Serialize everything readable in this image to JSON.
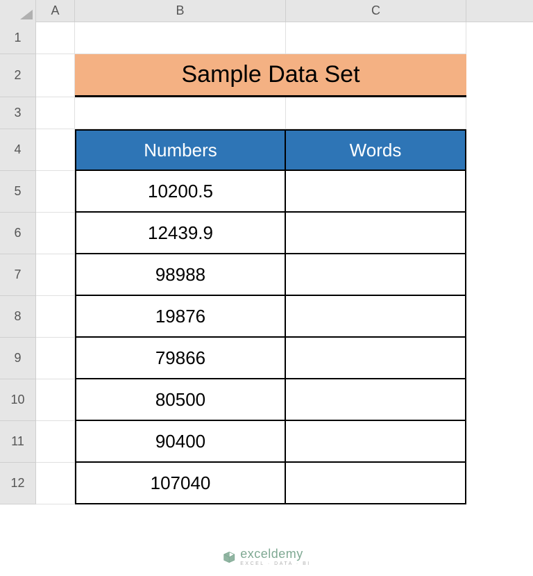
{
  "columns": {
    "A": "A",
    "B": "B",
    "C": "C"
  },
  "rows": [
    "1",
    "2",
    "3",
    "4",
    "5",
    "6",
    "7",
    "8",
    "9",
    "10",
    "11",
    "12"
  ],
  "title": "Sample Data Set",
  "headers": {
    "numbers": "Numbers",
    "words": "Words"
  },
  "data": [
    {
      "number": "10200.5",
      "word": ""
    },
    {
      "number": "12439.9",
      "word": ""
    },
    {
      "number": "98988",
      "word": ""
    },
    {
      "number": "19876",
      "word": ""
    },
    {
      "number": "79866",
      "word": ""
    },
    {
      "number": "80500",
      "word": ""
    },
    {
      "number": "90400",
      "word": ""
    },
    {
      "number": "107040",
      "word": ""
    }
  ],
  "watermark": {
    "main": "exceldemy",
    "sub": "EXCEL · DATA · BI"
  }
}
